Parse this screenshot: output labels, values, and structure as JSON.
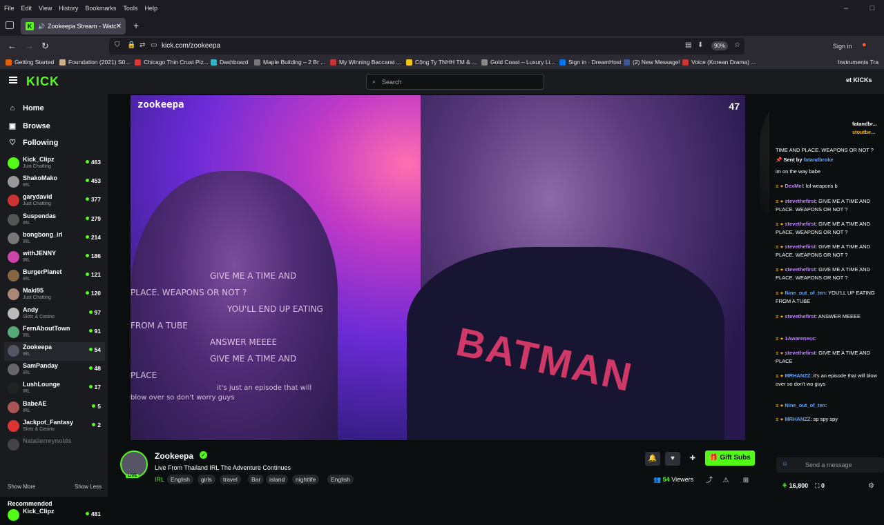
{
  "browser": {
    "menu": [
      "File",
      "Edit",
      "View",
      "History",
      "Bookmarks",
      "Tools",
      "Help"
    ],
    "tab_title": "Zookeepa Stream - Watch",
    "url": "kick.com/zookeepa",
    "zoom": "90%",
    "sign_in": "Sign in",
    "bookmarks": [
      {
        "label": "Getting Started",
        "color": "#e66000"
      },
      {
        "label": "Foundation (2021) S0...",
        "color": "#c9b08a"
      },
      {
        "label": "Chicago Thin Crust Piz...",
        "color": "#d33"
      },
      {
        "label": "Dashboard",
        "color": "#2ab7ca"
      },
      {
        "label": "Maple Building – 2 Br ...",
        "color": "#777"
      },
      {
        "label": "My Winning Baccarat ...",
        "color": "#c33"
      },
      {
        "label": "Công Ty TNHH TM & ...",
        "color": "#f5c518"
      },
      {
        "label": "Gold Coast – Luxury Li...",
        "color": "#888"
      },
      {
        "label": "Sign in · DreamHost",
        "color": "#0073ec"
      },
      {
        "label": "(2) New Message!",
        "color": "#3b5998"
      },
      {
        "label": "Voice (Korean Drama) ...",
        "color": "#c33"
      },
      {
        "label": "Instruments Tra",
        "color": "#888"
      }
    ]
  },
  "site": {
    "search_placeholder": "Search",
    "get_kicks": "et KICKs",
    "nav": [
      {
        "label": "Home",
        "icon": "home-icon"
      },
      {
        "label": "Browse",
        "icon": "browse-icon"
      },
      {
        "label": "Following",
        "icon": "heart-icon"
      }
    ],
    "following": [
      {
        "name": "Kick_Clipz",
        "cat": "Just Chatting",
        "count": "463",
        "color": "#53fc18"
      },
      {
        "name": "ShakoMako",
        "cat": "IRL",
        "count": "453",
        "color": "#999"
      },
      {
        "name": "garydavid",
        "cat": "Just Chatting",
        "count": "377",
        "color": "#c33"
      },
      {
        "name": "Suspendas",
        "cat": "IRL",
        "count": "279",
        "color": "#555"
      },
      {
        "name": "bongbong_irl",
        "cat": "IRL",
        "count": "214",
        "color": "#777"
      },
      {
        "name": "withJENNY",
        "cat": "IRL",
        "count": "186",
        "color": "#c4a"
      },
      {
        "name": "BurgerPlanet",
        "cat": "IRL",
        "count": "121",
        "color": "#864"
      },
      {
        "name": "Maki95",
        "cat": "Just Chatting",
        "count": "120",
        "color": "#a87"
      },
      {
        "name": "Andy",
        "cat": "Slots & Casino",
        "count": "97",
        "color": "#bbb"
      },
      {
        "name": "FernAboutTown",
        "cat": "IRL",
        "count": "91",
        "color": "#5a7"
      },
      {
        "name": "Zookeepa",
        "cat": "IRL",
        "count": "54",
        "color": "#556"
      },
      {
        "name": "SamPanday",
        "cat": "IRL",
        "count": "48",
        "color": "#666"
      },
      {
        "name": "LushLounge",
        "cat": "IRL",
        "count": "17",
        "color": "#222"
      },
      {
        "name": "BabeAE",
        "cat": "IRL",
        "count": "5",
        "color": "#a55"
      },
      {
        "name": "Jackpot_Fantasy",
        "cat": "Slots & Casino",
        "count": "2",
        "color": "#d33"
      },
      {
        "name": "Natalierreynolds",
        "cat": "",
        "count": "",
        "color": "#444"
      }
    ],
    "show_more": "Show More",
    "show_less": "Show Less",
    "recommended": "Recommended",
    "recommended_first": {
      "name": "Kick_Clipz",
      "count": "481"
    }
  },
  "stream": {
    "watermark": "zookeepa",
    "video_viewers": "47",
    "name": "Zookeepa",
    "title": "Live From Thailand IRL The Adventure Continues",
    "category": "IRL",
    "tags": [
      "English",
      "girls",
      "travel",
      "Bar",
      "island",
      "nightlife",
      "English"
    ],
    "viewers_count": "54",
    "viewers_label": "Viewers",
    "gift": "Gift Subs",
    "live_badge": "LIVE",
    "shirt_text": "BATMAN",
    "overlay_lines": [
      "GIVE ME A TIME AND",
      "PLACE. WEAPONS OR NOT ?",
      "YOU'LL END UP EATING",
      "FROM A TUBE",
      "ANSWER MEEEE",
      "GIVE ME A TIME AND",
      "PLACE",
      "it's just an episode that will",
      "blow over so don't worry guys"
    ]
  },
  "chat": {
    "pinned_users": [
      "fatandbr...",
      "stoutbe..."
    ],
    "pinned_text": "TIME AND PLACE. WEAPONS OR NOT ?",
    "sent_by": "Sent by",
    "sent_by_user": "fatandbroke",
    "sent_text": "im on the way babe",
    "messages": [
      {
        "user": "DexMel",
        "text": "lol weapons b",
        "color": "#c084fc"
      },
      {
        "user": "stevethefirst",
        "text": "GIVE ME A TIME AND PLACE. WEAPONS OR NOT ?",
        "color": "#c084fc"
      },
      {
        "user": "stevethefirst",
        "text": "GIVE ME A TIME AND PLACE. WEAPONS OR NOT ?",
        "color": "#c084fc"
      },
      {
        "user": "stevethefirst",
        "text": "GIVE ME A TIME AND PLACE. WEAPONS OR NOT ?",
        "color": "#c084fc"
      },
      {
        "user": "stevethefirst",
        "text": "GIVE ME A TIME AND PLACE. WEAPONS OR NOT ?",
        "color": "#c084fc"
      },
      {
        "user": "Nine_out_of_ten",
        "text": "YOU'LL UP EATING FROM A TUBE",
        "color": "#60a5fa"
      },
      {
        "user": "stevethefirst",
        "text": "ANSWER MEEEE",
        "color": "#c084fc"
      },
      {
        "user": "1Awareness",
        "text": "",
        "color": "#c084fc"
      },
      {
        "user": "stevethefirst",
        "text": "GIVE ME A TIME AND PLACE",
        "color": "#c084fc"
      },
      {
        "user": "MRHANZZ",
        "text": "it's an episode that will blow over so don't wo guys",
        "color": "#60a5fa"
      },
      {
        "user": "Nine_out_of_ten",
        "text": "",
        "color": "#60a5fa"
      },
      {
        "user": "MRHANZZ",
        "text": "sp spy spy",
        "color": "#60a5fa"
      }
    ],
    "input_placeholder": "Send a message",
    "points": "16,800",
    "counter": "0"
  }
}
